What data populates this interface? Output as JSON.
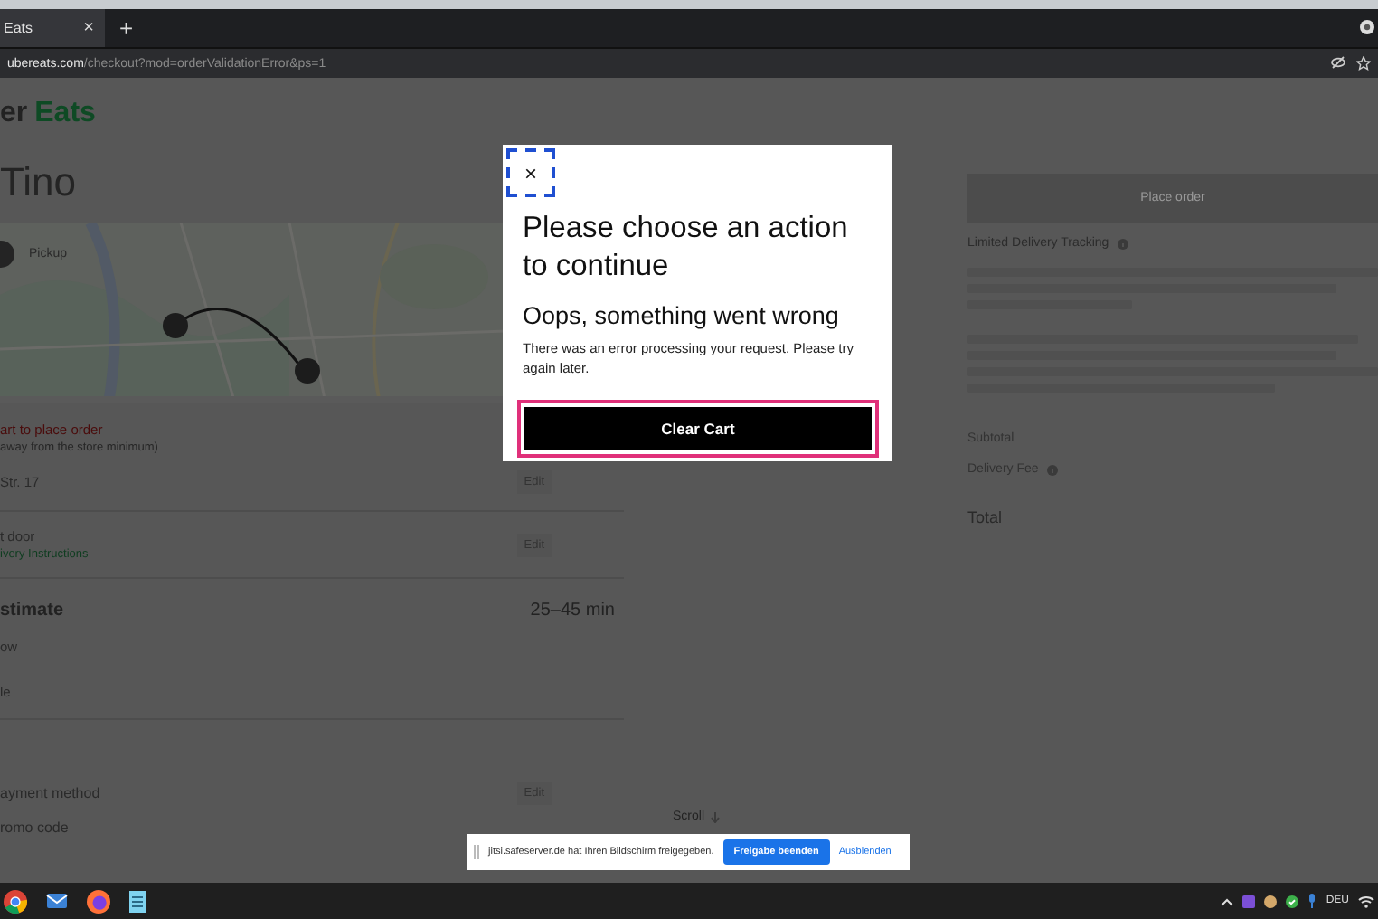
{
  "browser": {
    "tab": {
      "title": "Eats",
      "close": "×"
    },
    "new_tab": "+",
    "url": {
      "host": "ubereats.com",
      "path": "/checkout?mod=orderValidationError&ps=1"
    }
  },
  "page": {
    "logo": {
      "first": "er",
      "second": "Eats"
    },
    "store_name": "Tino",
    "mode_toggle": {
      "label": "Pickup"
    },
    "minimum_notice": {
      "title": "art to place order",
      "detail": "away from the store minimum)"
    },
    "rows": [
      {
        "label": "Str. 17",
        "action": "Edit"
      },
      {
        "label": "t door",
        "sublabel": "ivery Instructions",
        "action": "Edit"
      }
    ],
    "estimate": {
      "label": "stimate",
      "value": "25–45 min"
    },
    "options": [
      "ow",
      "le"
    ],
    "payment": {
      "label": "ayment method",
      "action": "Edit"
    },
    "promo": {
      "label": "romo code"
    },
    "scroll_hint": "Scroll",
    "summary": {
      "button": "Place order",
      "tracking": "Limited Delivery Tracking",
      "subtotal": "Subtotal",
      "delivery_fee": "Delivery Fee",
      "total": "Total"
    }
  },
  "modal": {
    "close": "×",
    "title": "Please choose an action to continue",
    "subtitle": "Oops, something went wrong",
    "message": "There was an error processing your request. Please try again later.",
    "button": "Clear Cart"
  },
  "share_bar": {
    "message": "jitsi.safeserver.de hat Ihren Bildschirm freigegeben.",
    "stop_button": "Freigabe beenden",
    "hide_link": "Ausblenden"
  },
  "taskbar": {
    "language": "DEU"
  }
}
